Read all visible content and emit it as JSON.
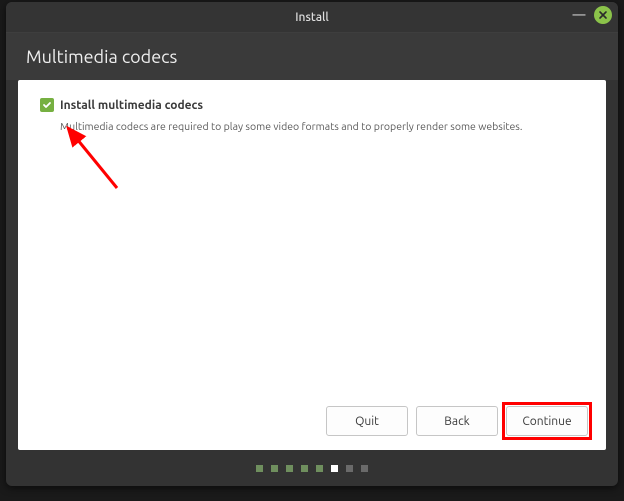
{
  "titlebar": {
    "title": "Install",
    "minimize_glyph": "—"
  },
  "header": {
    "title": "Multimedia codecs"
  },
  "checkbox": {
    "label": "Install multimedia codecs",
    "checked": true
  },
  "description": "Multimedia codecs are required to play some video formats and to properly render some websites.",
  "buttons": {
    "quit": "Quit",
    "back": "Back",
    "continue": "Continue"
  },
  "progress": {
    "total": 8,
    "current_index": 5
  },
  "colors": {
    "accent": "#8bc34a",
    "highlight": "#ff0000"
  },
  "annotation": {
    "arrow_target": "checkbox",
    "highlight_target": "continue-button"
  }
}
